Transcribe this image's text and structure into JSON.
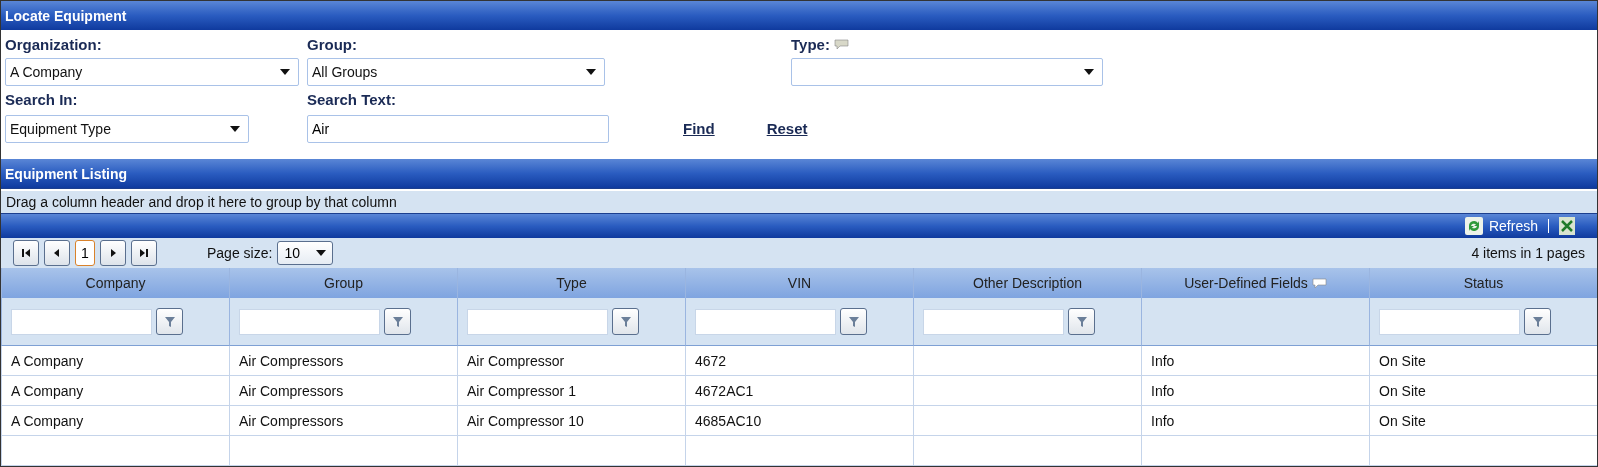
{
  "locate_panel": {
    "title": "Locate Equipment",
    "organization": {
      "label": "Organization:",
      "value": "A Company"
    },
    "group": {
      "label": "Group:",
      "value": "All Groups"
    },
    "type": {
      "label": "Type:"
    },
    "search_in": {
      "label": "Search In:",
      "value": "Equipment Type"
    },
    "search_text": {
      "label": "Search Text:",
      "value": "Air"
    },
    "links": [
      "Find",
      "Reset"
    ]
  },
  "listing_panel": {
    "title": "Equipment Listing",
    "group_hint": "Drag a column header and drop it here to group by that column",
    "toolbar": {
      "refresh": "Refresh"
    },
    "pager": {
      "pages": [
        {
          "label": "1",
          "selected": true
        }
      ],
      "page_size_label": "Page size:",
      "page_size": "10",
      "summary": "4 items in 1 pages"
    },
    "columns": [
      {
        "label": "Company",
        "filterable": true,
        "has_note": false
      },
      {
        "label": "Group",
        "filterable": true,
        "has_note": false
      },
      {
        "label": "Type",
        "filterable": true,
        "has_note": false
      },
      {
        "label": "VIN",
        "filterable": true,
        "has_note": false
      },
      {
        "label": "Other Description",
        "filterable": true,
        "has_note": false
      },
      {
        "label": "User-Defined Fields",
        "filterable": false,
        "has_note": true
      },
      {
        "label": "Status",
        "filterable": true,
        "has_note": false
      }
    ],
    "rows": [
      [
        "A Company",
        "Air Compressors",
        "Air Compressor",
        "4672",
        "",
        "Info",
        "On Site"
      ],
      [
        "A Company",
        "Air Compressors",
        "Air Compressor 1",
        "4672AC1",
        "",
        "Info",
        "On Site"
      ],
      [
        "A Company",
        "Air Compressors",
        "Air Compressor 10",
        "4685AC10",
        "",
        "Info",
        "On Site"
      ],
      [
        "",
        "",
        "",
        "",
        "",
        "",
        ""
      ]
    ]
  }
}
